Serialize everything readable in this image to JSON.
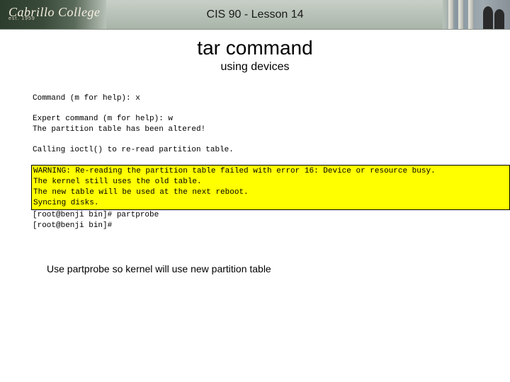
{
  "header": {
    "logo_main": "Cabrillo College",
    "logo_sub": "est. 1959",
    "title": "CIS 90 - Lesson 14"
  },
  "main": {
    "title": "tar command",
    "subtitle": "using devices"
  },
  "terminal": {
    "line1": "Command (m for help): x",
    "line2": "Expert command (m for help): w",
    "line3": "The partition table has been altered!",
    "line4": "Calling ioctl() to re-read partition table.",
    "warn1": "WARNING: Re-reading the partition table failed with error 16: Device or resource busy.",
    "warn2": "The kernel still uses the old table.",
    "warn3": "The new table will be used at the next reboot.",
    "warn4": "Syncing disks.",
    "after1": "[root@benji bin]# partprobe",
    "after2": "[root@benji bin]#"
  },
  "footer": {
    "note": "Use partprobe so kernel will use new partition table"
  }
}
